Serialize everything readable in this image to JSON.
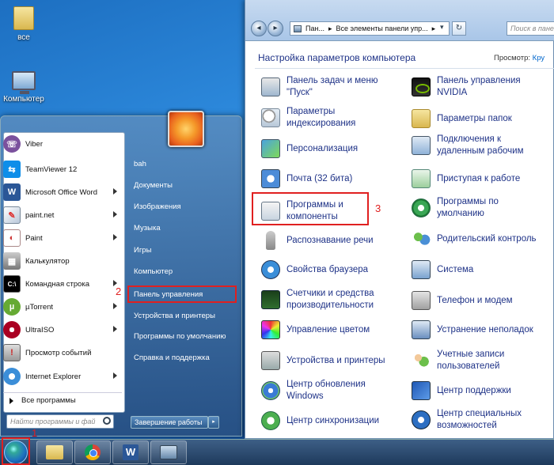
{
  "desktop": {
    "icons": [
      {
        "label": "все"
      },
      {
        "label": "Компьютер"
      }
    ]
  },
  "start_menu": {
    "pinned": [
      {
        "label": "Viber",
        "icon": "viber-icon",
        "has_arrow": false
      },
      {
        "label": "TeamViewer 12",
        "icon": "teamviewer-icon",
        "has_arrow": false
      },
      {
        "label": "Microsoft Office Word",
        "icon": "word-icon",
        "has_arrow": true
      },
      {
        "label": "paint.net",
        "icon": "paintnet-icon",
        "has_arrow": true
      },
      {
        "label": "Paint",
        "icon": "paint-icon",
        "has_arrow": true
      },
      {
        "label": "Калькулятор",
        "icon": "calculator-icon",
        "has_arrow": false
      },
      {
        "label": "Командная строка",
        "icon": "cmd-icon",
        "has_arrow": true
      },
      {
        "label": "µTorrent",
        "icon": "utorrent-icon",
        "has_arrow": true
      },
      {
        "label": "UltraISO",
        "icon": "ultraiso-icon",
        "has_arrow": true
      },
      {
        "label": "Просмотр событий",
        "icon": "event-viewer-icon",
        "has_arrow": false
      },
      {
        "label": "Internet Explorer",
        "icon": "ie-icon",
        "has_arrow": true
      }
    ],
    "all_programs": "Все программы",
    "search_placeholder": "Найти программы и фай",
    "right_items": [
      "bah",
      "Документы",
      "Изображения",
      "Музыка",
      "Игры",
      "Компьютер",
      "Панель управления",
      "Устройства и принтеры",
      "Программы по умолчанию",
      "Справка и поддержка"
    ],
    "shutdown": "Завершение работы",
    "shutdown_arrow": "▸"
  },
  "annotations": {
    "one": "1",
    "two": "2",
    "three": "3"
  },
  "control_panel": {
    "nav_back": "◂",
    "nav_forward": "▸",
    "address_parts": [
      "Пан...",
      "▸",
      "Все элементы панели упр...",
      "▸"
    ],
    "address_dropdown": "▾",
    "refresh": "↻",
    "search_placeholder": "Поиск в пане",
    "title": "Настройка параметров компьютера",
    "view_label": "Просмотр:",
    "view_value": "Кру",
    "items_left": [
      {
        "label": "Панель задач и меню \"Пуск\"",
        "icon": "taskbar-icon"
      },
      {
        "label": "Параметры индексирования",
        "icon": "indexing-icon"
      },
      {
        "label": "Персонализация",
        "icon": "personalization-icon"
      },
      {
        "label": "Почта (32 бита)",
        "icon": "mail-icon"
      },
      {
        "label": "Программы и компоненты",
        "icon": "programs-icon"
      },
      {
        "label": "Распознавание речи",
        "icon": "microphone-icon"
      },
      {
        "label": "Свойства браузера",
        "icon": "browser-icon"
      },
      {
        "label": "Счетчики и средства производительности",
        "icon": "performance-icon"
      },
      {
        "label": "Управление цветом",
        "icon": "color-icon"
      },
      {
        "label": "Устройства и принтеры",
        "icon": "devices-icon"
      },
      {
        "label": "Центр обновления Windows",
        "icon": "windows-update-icon"
      },
      {
        "label": "Центр синхронизации",
        "icon": "sync-icon"
      }
    ],
    "items_right": [
      {
        "label": "Панель управления NVIDIA",
        "icon": "nvidia-icon"
      },
      {
        "label": "Параметры папок",
        "icon": "folder-options-icon"
      },
      {
        "label": "Подключения к удаленным рабочим",
        "icon": "remote-icon"
      },
      {
        "label": "Приступая к работе",
        "icon": "getting-started-icon"
      },
      {
        "label": "Программы по умолчанию",
        "icon": "default-programs-icon"
      },
      {
        "label": "Родительский контроль",
        "icon": "parental-icon"
      },
      {
        "label": "Система",
        "icon": "system-icon"
      },
      {
        "label": "Телефон и модем",
        "icon": "phone-icon"
      },
      {
        "label": "Устранение неполадок",
        "icon": "troubleshoot-icon"
      },
      {
        "label": "Учетные записи пользователей",
        "icon": "users-icon"
      },
      {
        "label": "Центр поддержки",
        "icon": "support-icon"
      },
      {
        "label": "Центр специальных возможностей",
        "icon": "accessibility-icon"
      }
    ]
  },
  "taskbar": {
    "apps": [
      {
        "icon": "explorer-icon"
      },
      {
        "icon": "chrome-icon"
      },
      {
        "icon": "word-icon"
      },
      {
        "icon": "control-panel-icon"
      }
    ]
  }
}
